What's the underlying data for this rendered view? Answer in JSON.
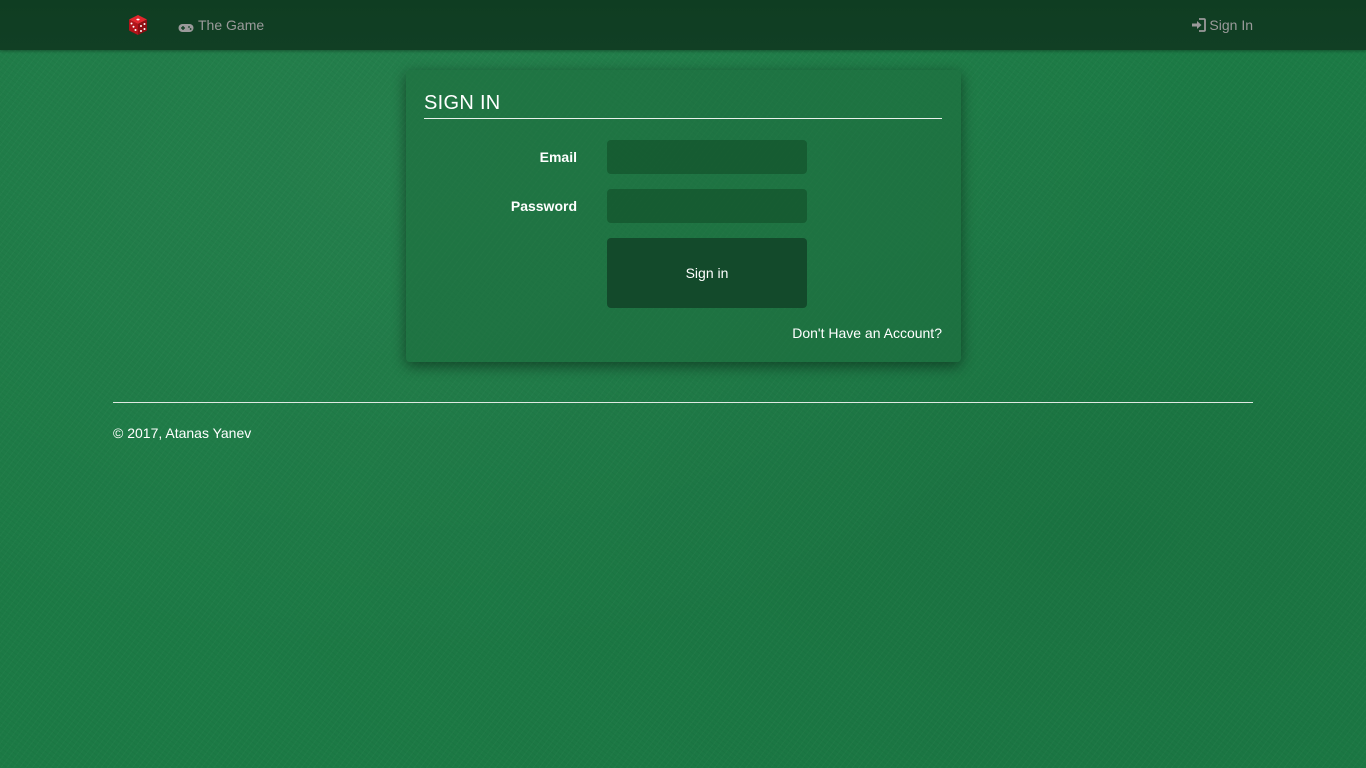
{
  "colors": {
    "background": "#1c7a45",
    "navbar": "#0f3d22",
    "panel": "#1e6e3e",
    "button": "#134a2b",
    "nav_text": "#9a9a9a",
    "dice": "#c0141b"
  },
  "navbar": {
    "brand_icon": "dice-icon",
    "game_icon": "gamepad-icon",
    "game_label": "The Game",
    "signin_icon": "sign-in-icon",
    "signin_label": "Sign In"
  },
  "form": {
    "title": "SIGN IN",
    "email_label": "Email",
    "email_value": "",
    "password_label": "Password",
    "password_value": "",
    "submit_label": "Sign in",
    "register_link": "Don't Have an Account?"
  },
  "footer": {
    "copyright": "© 2017, Atanas Yanev"
  }
}
